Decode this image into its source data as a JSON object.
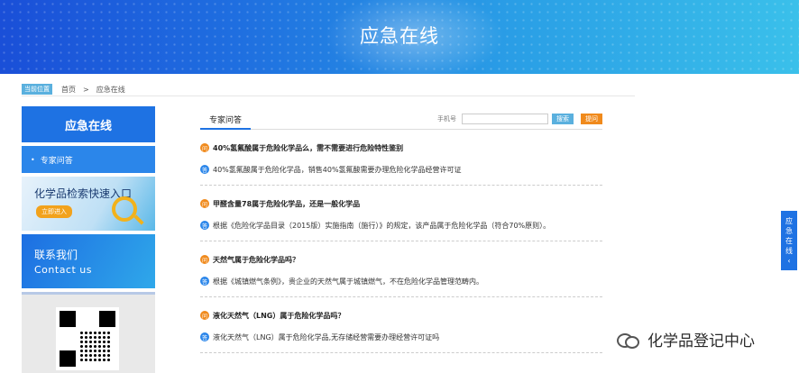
{
  "banner": {
    "title": "应急在线"
  },
  "breadcrumb": {
    "tag": "当前位置",
    "home": "首页",
    "sep": ">",
    "current": "应急在线"
  },
  "sidebar": {
    "header": "应急在线",
    "item": "专家问答",
    "item_bullet": "•",
    "promo": {
      "title": "化学品检索快速入口",
      "button": "立即进入"
    },
    "contact": {
      "cn": "联系我们",
      "en": "Contact us"
    }
  },
  "main": {
    "tab": "专家问答",
    "search": {
      "label": "手机号",
      "phone_value": "",
      "search_btn": "搜索",
      "ask_btn": "提问"
    },
    "qa": [
      {
        "q": "40%氢氟酸属于危险化学品么，需不需要进行危险特性鉴别",
        "a": "40%氢氟酸属于危险化学品，销售40%氢氟酸需要办理危险化学品经营许可证"
      },
      {
        "q": "甲醛含量78属于危险化学品，还是一般化学品",
        "a": "根据《危险化学品目录（2015版）实施指南（施行）》的规定，该产品属于危险化学品（符合70%原则）。"
      },
      {
        "q": "天然气属于危险化学品吗？",
        "a": "根据《城镇燃气条例》，贵企业的天然气属于城镇燃气，不在危险化学品管理范畴内。"
      },
      {
        "q": "液化天然气（LNG）属于危险化学品吗？",
        "a": "液化天然气（LNG）属于危险化学品,无存储经营需要办理经营许可证吗"
      }
    ],
    "q_icon": "问",
    "a_icon": "答"
  },
  "floatbar": {
    "text": "应急在线"
  },
  "floatbar_arrow": "‹",
  "watermark": {
    "text": "化学品登记中心"
  }
}
